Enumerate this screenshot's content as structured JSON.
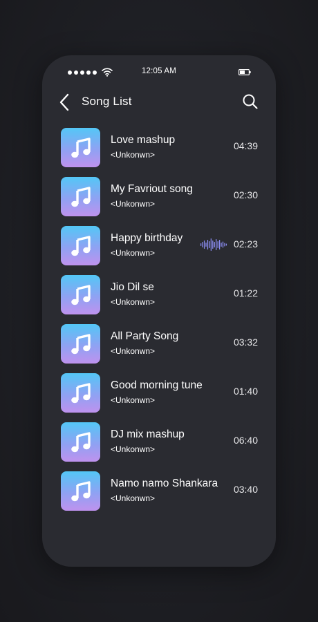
{
  "status_bar": {
    "time": "12:05 AM"
  },
  "header": {
    "title": "Song List",
    "back_icon": "chevron-left-icon",
    "search_icon": "search-icon"
  },
  "colors": {
    "background": "#1c1d22",
    "phone_surface": "#2a2b31",
    "art_gradient_top": "#53c7f6",
    "art_gradient_bottom": "#bf92ee",
    "waveform": "#8a8cf0"
  },
  "songs": [
    {
      "title": "Love mashup",
      "artist": "<Unkonwn>",
      "duration": "04:39",
      "playing": false
    },
    {
      "title": "My Favriout song",
      "artist": "<Unkonwn>",
      "duration": "02:30",
      "playing": false
    },
    {
      "title": "Happy birthday",
      "artist": "<Unkonwn>",
      "duration": "02:23",
      "playing": true
    },
    {
      "title": "Jio Dil se",
      "artist": "<Unkonwn>",
      "duration": "01:22",
      "playing": false
    },
    {
      "title": "All Party Song",
      "artist": "<Unkonwn>",
      "duration": "03:32",
      "playing": false
    },
    {
      "title": "Good morning tune",
      "artist": "<Unkonwn>",
      "duration": "01:40",
      "playing": false
    },
    {
      "title": "DJ mix mashup",
      "artist": "<Unkonwn>",
      "duration": "06:40",
      "playing": false
    },
    {
      "title": "Namo namo Shankara",
      "artist": "<Unkonwn>",
      "duration": "03:40",
      "playing": false
    }
  ]
}
